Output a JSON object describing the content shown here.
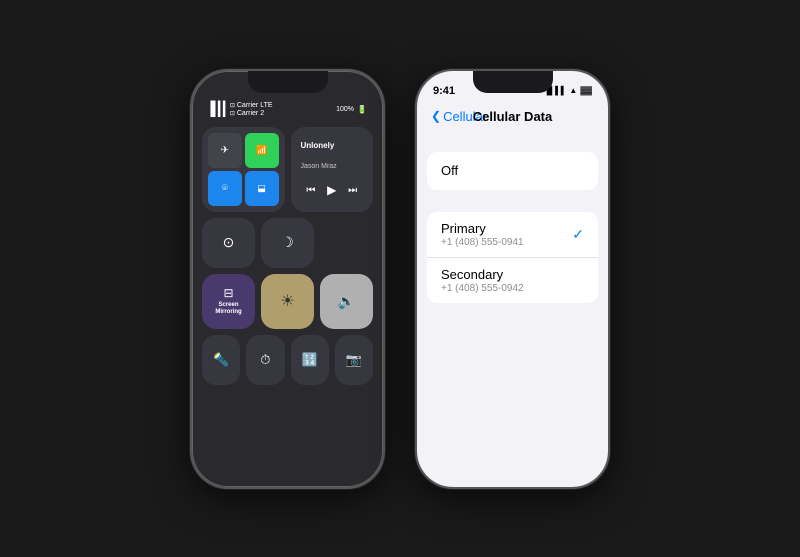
{
  "phone1": {
    "label": "iPhone Control Center",
    "status": {
      "carrier1": "Carrier LTE",
      "carrier2": "Carrier 2",
      "battery": "100%"
    },
    "tiles": {
      "airplane": "✈",
      "cellular": "📶",
      "wifi": "wifi",
      "bluetooth": "bluetooth",
      "music": {
        "title": "Unlonely",
        "artist": "Jason Mraz",
        "prev": "⏮",
        "play": "▶",
        "next": "⏭"
      },
      "rotation": "rotation",
      "doNotDisturb": "moon",
      "screenMirroring": "Screen\nMirroring",
      "brightness": "sun",
      "volume": "speaker",
      "flashlight": "flashlight",
      "timer": "timer",
      "calculator": "calc",
      "camera": "camera"
    }
  },
  "phone2": {
    "label": "iPhone Settings",
    "status": {
      "time": "9:41"
    },
    "navigation": {
      "back_label": "Cellular",
      "title": "Cellular Data"
    },
    "options": [
      {
        "id": "off",
        "label": "Off",
        "sublabel": "",
        "checked": false
      },
      {
        "id": "primary",
        "label": "Primary",
        "sublabel": "+1 (408) 555-0941",
        "checked": true
      },
      {
        "id": "secondary",
        "label": "Secondary",
        "sublabel": "+1 (408) 555-0942",
        "checked": false
      }
    ]
  }
}
